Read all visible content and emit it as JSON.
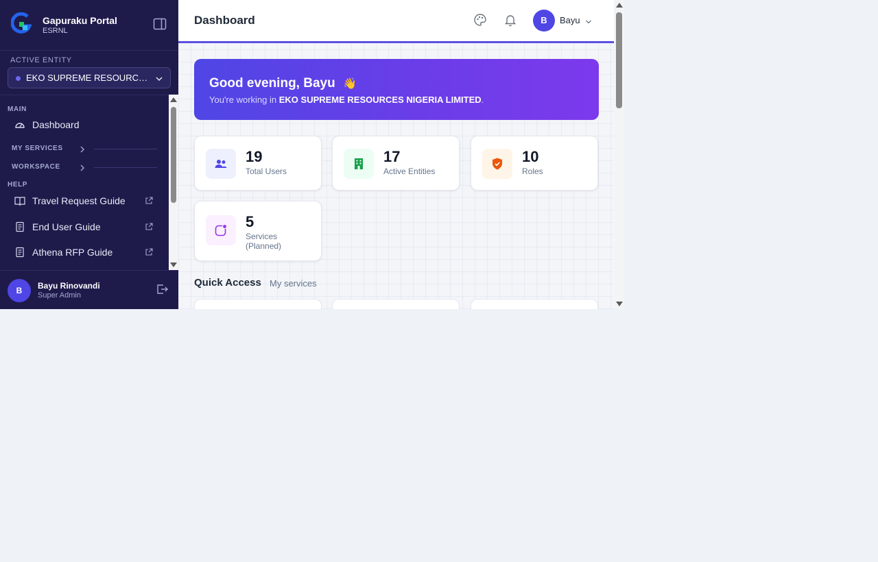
{
  "brand": {
    "name": "Gapuraku Portal",
    "sub": "ESRNL",
    "logo_icon": "gapuraku-g-logo"
  },
  "entity": {
    "label": "ACTIVE ENTITY",
    "value": "EKO SUPREME RESOURCE..."
  },
  "sidebar": {
    "main_label": "MAIN",
    "dashboard_label": "Dashboard",
    "my_services_label": "MY SERVICES",
    "workspace_label": "WORKSPACE",
    "help_label": "HELP",
    "help_items": [
      {
        "label": "Travel Request Guide",
        "icon": "book-open-icon"
      },
      {
        "label": "End User Guide",
        "icon": "document-icon"
      },
      {
        "label": "Athena RFP Guide",
        "icon": "document-icon"
      }
    ]
  },
  "user": {
    "initial": "B",
    "name": "Bayu Rinovandi",
    "role": "Super Admin"
  },
  "header": {
    "title": "Dashboard",
    "user_initial": "B",
    "user_name": "Bayu"
  },
  "banner": {
    "greeting": "Good evening, Bayu",
    "emoji": "👋",
    "sub_prefix": "You're working in ",
    "entity": "EKO SUPREME RESOURCES NIGERIA LIMITED",
    "sub_suffix": "."
  },
  "stats": [
    {
      "value": "19",
      "label": "Total Users",
      "icon": "users-icon",
      "color": "#4f46e5",
      "bg": "#eef0fd"
    },
    {
      "value": "17",
      "label": "Active Entities",
      "icon": "building-icon",
      "color": "#16a34a",
      "bg": "#ecfdf3"
    },
    {
      "value": "10",
      "label": "Roles",
      "icon": "shield-check-icon",
      "color": "#ea580c",
      "bg": "#fff4e8"
    },
    {
      "value": "5",
      "label": "Services (Planned)",
      "icon": "service-dot-icon",
      "color": "#9333ea",
      "bg": "#fbf0ff"
    }
  ],
  "quick_access": {
    "title": "Quick Access",
    "subtitle": "My services"
  },
  "colors": {
    "sidebar": "#1e1b4b",
    "accent": "#4f46e5",
    "banner_end": "#7c3aed"
  }
}
